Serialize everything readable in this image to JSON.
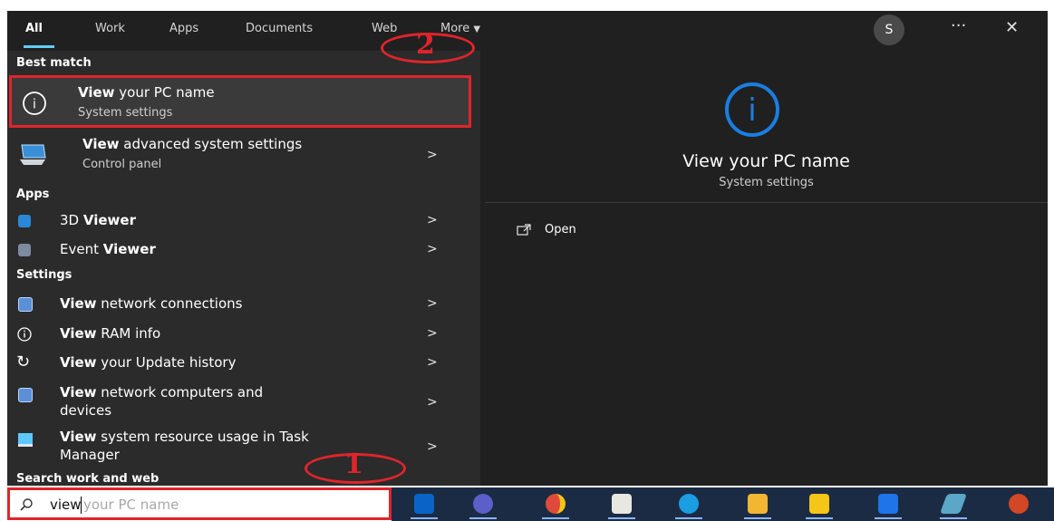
{
  "tabs": [
    "All",
    "Work",
    "Apps",
    "Documents",
    "Web",
    "More"
  ],
  "more_arrow": "▼",
  "user_initial": "S",
  "more_options": "···",
  "close": "✕",
  "sections": {
    "best": "Best match",
    "apps": "Apps",
    "settings": "Settings",
    "web": "Search work and web"
  },
  "best": {
    "b1": {
      "bold": "View",
      "rest": " your PC name",
      "sub": "System settings"
    },
    "b2": {
      "bold": "View",
      "rest": " advanced system settings",
      "sub": "Control panel"
    }
  },
  "apps": {
    "a1": {
      "pre": "3D ",
      "bold": "Viewer"
    },
    "a2": {
      "pre": "Event ",
      "bold": "Viewer"
    }
  },
  "settings": {
    "s1": {
      "bold": "View",
      "rest": " network connections"
    },
    "s2": {
      "bold": "View",
      "rest": " RAM info"
    },
    "s3": {
      "bold": "View",
      "rest": " your Update history"
    },
    "s4": {
      "bold": "View",
      "rest": " network computers and",
      "rest2": "devices"
    },
    "s5": {
      "bold": "View",
      "rest": " system resource usage in Task",
      "rest2": "Manager"
    }
  },
  "chevron": ">",
  "detail": {
    "title": "View your PC name",
    "subtitle": "System settings",
    "open": "Open"
  },
  "search": {
    "typed": "view",
    "suggest": "your PC name"
  },
  "annotations": {
    "one": "1",
    "two": "2"
  },
  "icons": {
    "info": "i",
    "info_small": "i",
    "monitor": "monitor-icon",
    "cube": "cube-icon",
    "event": "event-viewer-icon",
    "network": "network-icon",
    "refresh": "↻",
    "open": "open-icon",
    "search": "search-icon"
  },
  "colors": {
    "accent": "#0078d4",
    "highlight": "#e0242b",
    "taskbar": "#1c2b44"
  }
}
